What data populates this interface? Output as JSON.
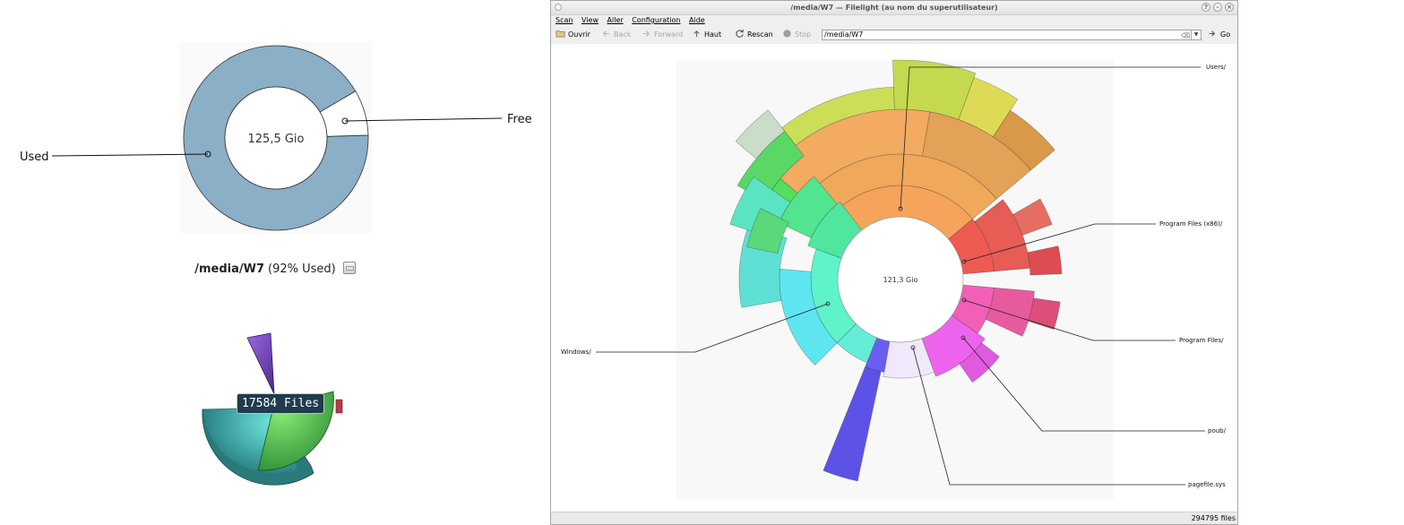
{
  "preview": {
    "donut": {
      "center_label": "125,5 Gio",
      "used_label": "Used",
      "free_label": "Free",
      "used_fraction": 0.92,
      "used_color": "#8aafc7",
      "free_color": "#ffffff"
    },
    "drive": {
      "path": "/media/W7",
      "usage_text": "(92% Used)",
      "mount_icon": "drive-icon"
    },
    "tooltip": "17584 Files"
  },
  "window": {
    "title": "/media/W7 — Filelight (au nom du superutilisateur)",
    "buttons": {
      "help": "?",
      "minimize": "–",
      "close": "×"
    },
    "menu": [
      "Scan",
      "View",
      "Aller",
      "Configuration",
      "Aide"
    ],
    "toolbar": {
      "open": "Ouvrir",
      "back": "Back",
      "forward": "Forward",
      "up": "Haut",
      "rescan": "Rescan",
      "stop": "Stop",
      "url": "/media/W7",
      "go": "Go"
    },
    "map": {
      "center_label": "121,3 Gio",
      "labels": {
        "users": "Users/",
        "program_files_x86": "Program Files (x86)/",
        "program_files": "Program Files/",
        "windows": "Windows/",
        "poub": "poub/",
        "pagefile": "pagefile.sys"
      }
    },
    "status": "294795 files"
  }
}
